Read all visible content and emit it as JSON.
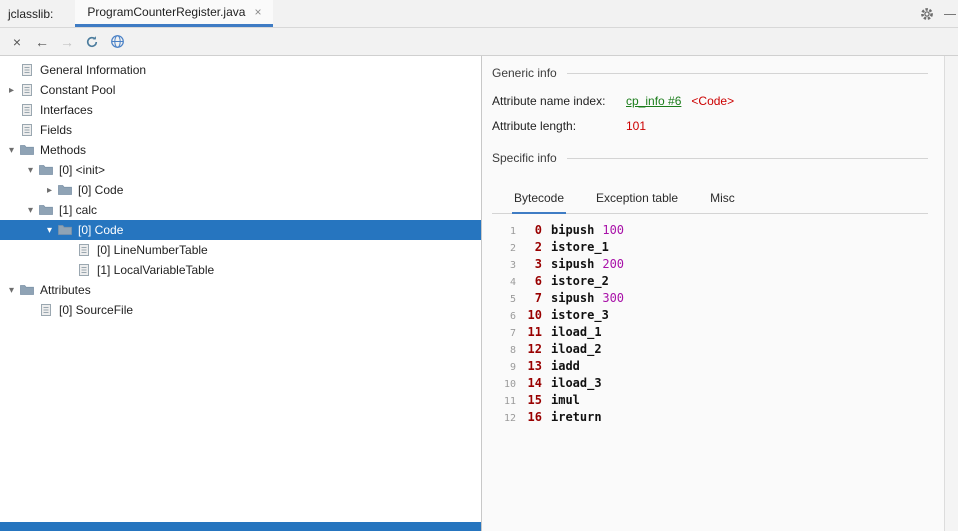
{
  "window": {
    "app_label": "jclasslib:",
    "minimize_glyph": "—"
  },
  "tab_bar": {
    "active_tab": "ProgramCounterRegister.java",
    "close_glyph": "×"
  },
  "toolbar": {
    "close_glyph": "×",
    "back_glyph": "←",
    "forward_glyph": "→"
  },
  "tree": {
    "items": [
      {
        "label": "General Information",
        "level": 0,
        "chevron": "none",
        "icon": "doc",
        "selected": false
      },
      {
        "label": "Constant Pool",
        "level": 0,
        "chevron": "collapsed",
        "icon": "doc",
        "selected": false
      },
      {
        "label": "Interfaces",
        "level": 0,
        "chevron": "none",
        "icon": "doc",
        "selected": false
      },
      {
        "label": "Fields",
        "level": 0,
        "chevron": "none",
        "icon": "doc",
        "selected": false
      },
      {
        "label": "Methods",
        "level": 0,
        "chevron": "expanded",
        "icon": "folder",
        "selected": false
      },
      {
        "label": "[0] <init>",
        "level": 1,
        "chevron": "expanded",
        "icon": "folder",
        "selected": false
      },
      {
        "label": "[0] Code",
        "level": 2,
        "chevron": "collapsed",
        "icon": "folder",
        "selected": false
      },
      {
        "label": "[1] calc",
        "level": 1,
        "chevron": "expanded",
        "icon": "folder",
        "selected": false
      },
      {
        "label": "[0] Code",
        "level": 2,
        "chevron": "expanded",
        "icon": "folder",
        "selected": true
      },
      {
        "label": "[0] LineNumberTable",
        "level": 3,
        "chevron": "none",
        "icon": "doc",
        "selected": false
      },
      {
        "label": "[1] LocalVariableTable",
        "level": 3,
        "chevron": "none",
        "icon": "doc",
        "selected": false
      },
      {
        "label": "Attributes",
        "level": 0,
        "chevron": "expanded",
        "icon": "folder",
        "selected": false
      },
      {
        "label": "[0] SourceFile",
        "level": 1,
        "chevron": "none",
        "icon": "doc",
        "selected": false
      }
    ]
  },
  "detail": {
    "generic_title": "Generic info",
    "attr_name_label": "Attribute name index:",
    "attr_name_link": "cp_info #6",
    "attr_name_type": "<Code>",
    "attr_length_label": "Attribute length:",
    "attr_length_value": "101",
    "specific_title": "Specific info",
    "tabs": [
      {
        "label": "Bytecode",
        "active": true
      },
      {
        "label": "Exception table",
        "active": false
      },
      {
        "label": "Misc",
        "active": false
      }
    ],
    "bytecode": [
      {
        "line": "1",
        "offset": "0",
        "mnemonic": "bipush",
        "operand": "100"
      },
      {
        "line": "2",
        "offset": "2",
        "mnemonic": "istore_1",
        "operand": ""
      },
      {
        "line": "3",
        "offset": "3",
        "mnemonic": "sipush",
        "operand": "200"
      },
      {
        "line": "4",
        "offset": "6",
        "mnemonic": "istore_2",
        "operand": ""
      },
      {
        "line": "5",
        "offset": "7",
        "mnemonic": "sipush",
        "operand": "300"
      },
      {
        "line": "6",
        "offset": "10",
        "mnemonic": "istore_3",
        "operand": ""
      },
      {
        "line": "7",
        "offset": "11",
        "mnemonic": "iload_1",
        "operand": ""
      },
      {
        "line": "8",
        "offset": "12",
        "mnemonic": "iload_2",
        "operand": ""
      },
      {
        "line": "9",
        "offset": "13",
        "mnemonic": "iadd",
        "operand": ""
      },
      {
        "line": "10",
        "offset": "14",
        "mnemonic": "iload_3",
        "operand": ""
      },
      {
        "line": "11",
        "offset": "15",
        "mnemonic": "imul",
        "operand": ""
      },
      {
        "line": "12",
        "offset": "16",
        "mnemonic": "ireturn",
        "operand": ""
      }
    ]
  },
  "colors": {
    "selection": "#2675bf",
    "tab_underline": "#3f7cc4",
    "link_green": "#1b7d1b",
    "value_red": "#cc0000",
    "offset_red": "#990000",
    "operand_magenta": "#a811a8"
  }
}
